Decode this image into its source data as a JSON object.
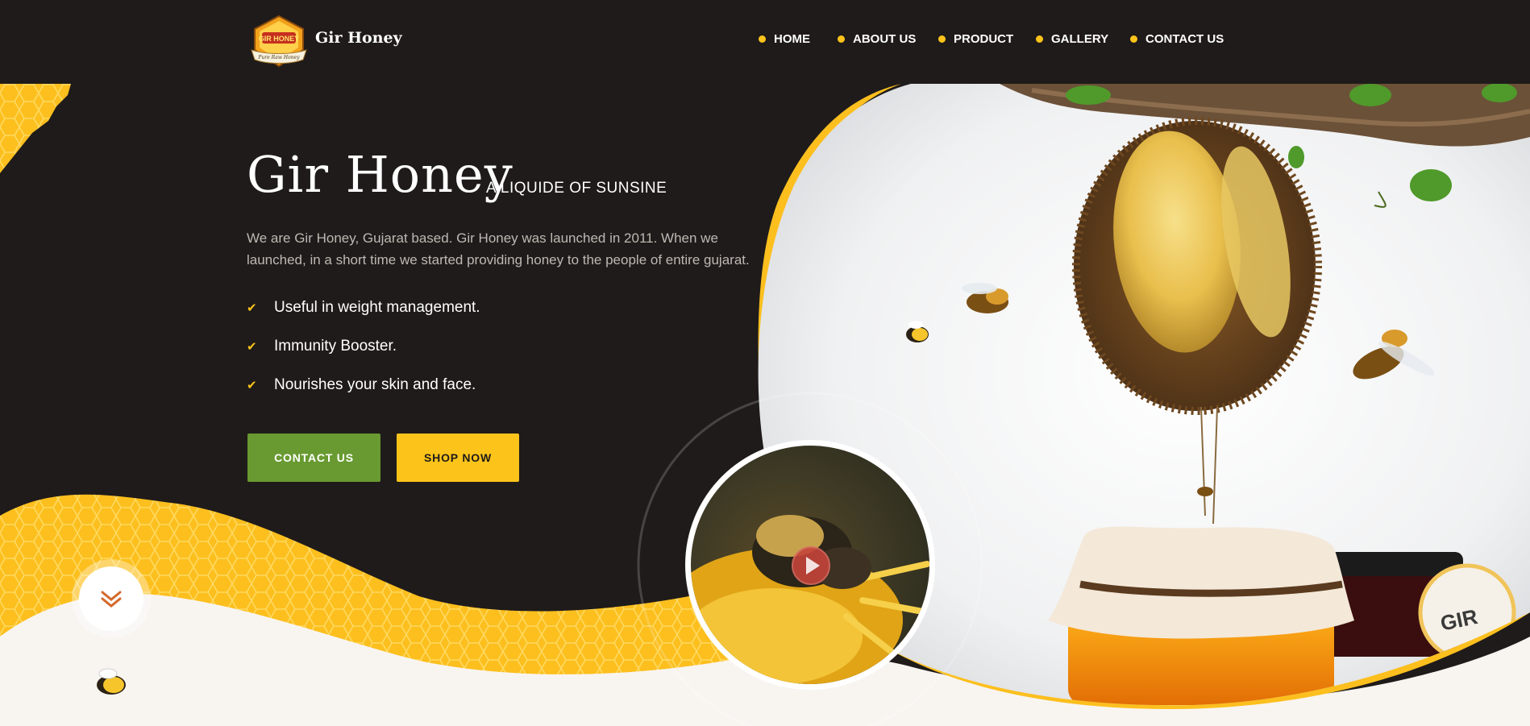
{
  "brand": {
    "name": "Gir Honey",
    "logo_top_text": "GIR HONEY",
    "logo_bottom_text": "Pure Raw Honey"
  },
  "nav": {
    "items": [
      {
        "label": "HOME"
      },
      {
        "label": "ABOUT US"
      },
      {
        "label": "PRODUCT"
      },
      {
        "label": "GALLERY"
      },
      {
        "label": "CONTACT US"
      }
    ]
  },
  "hero": {
    "title": "Gir Honey",
    "tagline": "A LIQUIDE OF SUNSINE",
    "intro": "We are Gir Honey, Gujarat based. Gir Honey was launched in 2011. When we launched, in a short time we started providing honey to the people of entire gujarat.",
    "features": [
      {
        "text": "Useful in weight management."
      },
      {
        "text": "Immunity Booster."
      },
      {
        "text": "Nourishes your skin and face."
      }
    ],
    "contact_button": "CONTACT US",
    "shop_button": "SHOP NOW",
    "jar_label": "GIR"
  },
  "colors": {
    "background": "#1f1b1a",
    "accent_yellow": "#fcc41a",
    "accent_green": "#689a31",
    "cream": "#f8f5f1"
  }
}
